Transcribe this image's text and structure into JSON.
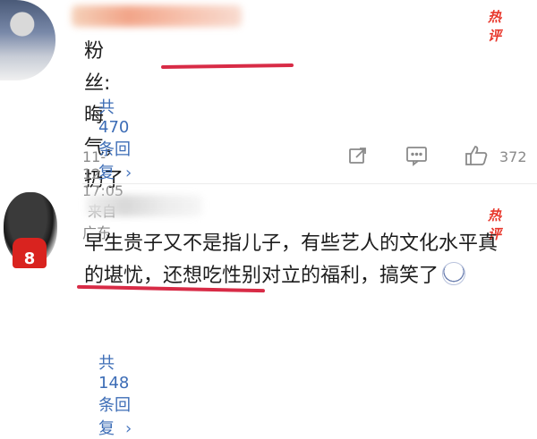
{
  "comments": [
    {
      "text": "粉丝:晦气，扔了",
      "badge": "热评",
      "reply_label": "共470条回复",
      "chevron": "›",
      "time": "11-12 17:05",
      "source": "来自广东",
      "likes": "372"
    },
    {
      "text": "早生贵子又不是指儿子，有些艺人的文化水平真的堪忧，还想吃性别对立的福利，搞笑了",
      "badge": "热评",
      "avatar_number": "8",
      "reply_label": "共148条回复",
      "chevron": "›"
    }
  ],
  "icons": {
    "share": "share-icon",
    "comment": "comment-icon",
    "like": "thumbs-up-icon",
    "emoji": "grinning-sweat-emoji-icon"
  },
  "colors": {
    "link": "#3d6db6",
    "badge": "#e8372c",
    "underline": "#d82b46",
    "meta": "#8a8a8a"
  }
}
